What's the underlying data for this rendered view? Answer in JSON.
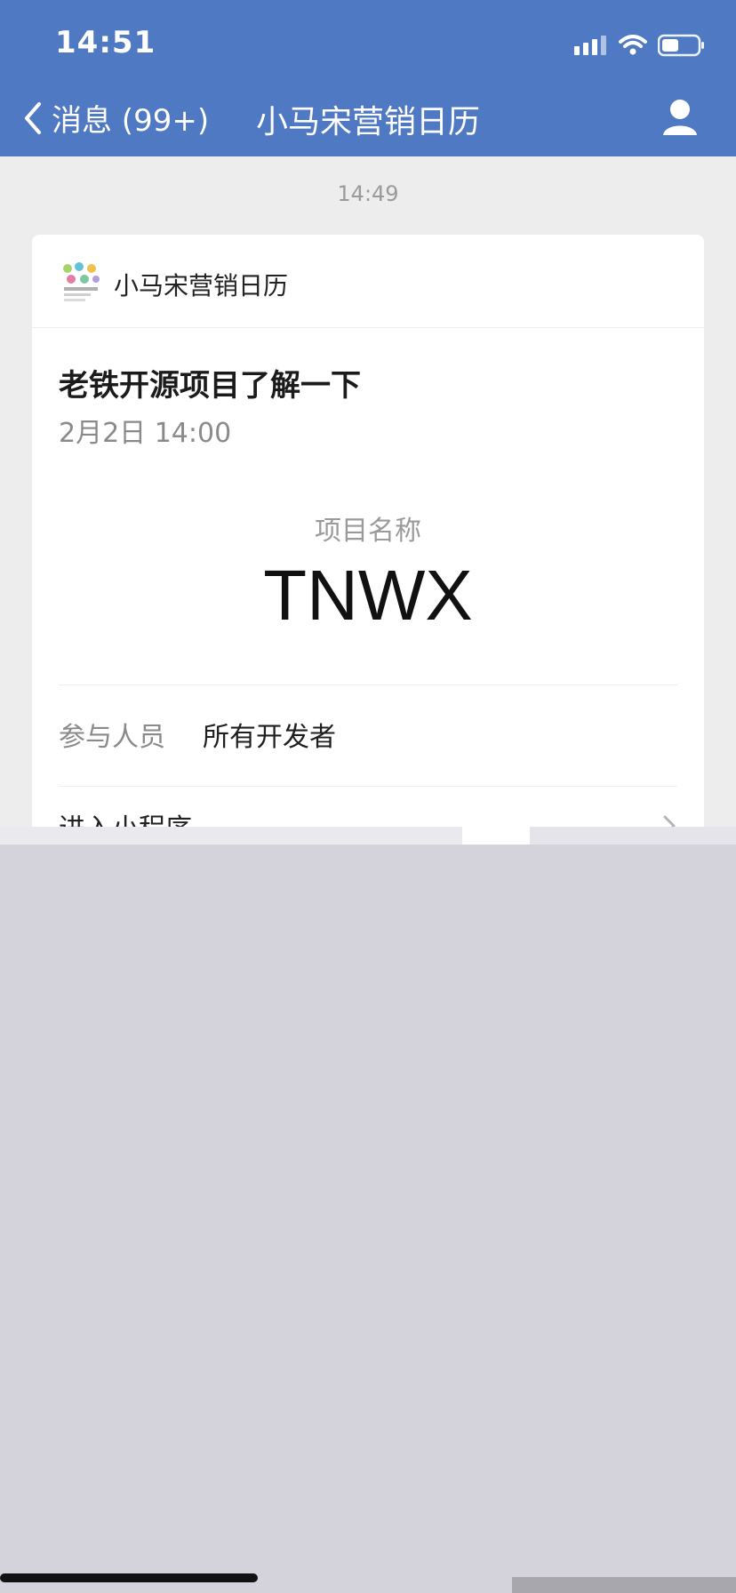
{
  "status_bar": {
    "time": "14:51"
  },
  "nav": {
    "back_label": "消息 (99+)",
    "title": "小马宋营销日历"
  },
  "chat": {
    "timestamp": "14:49"
  },
  "card": {
    "app_name": "小马宋营销日历",
    "title": "老铁开源项目了解一下",
    "datetime": "2月2日 14:00",
    "project_label": "项目名称",
    "project_name": "TNWX",
    "participants_label": "参与人员",
    "participants_value": "所有开发者",
    "enter_label": "进入小程序"
  },
  "icons": {
    "signal": "signal-icon",
    "wifi": "wifi-icon",
    "battery": "battery-icon",
    "back": "chevron-left-icon",
    "profile": "user-icon",
    "chevron": "chevron-right-icon"
  },
  "colors": {
    "nav_bg": "#4f79c2",
    "page_bg": "#ededed",
    "overlay_bg": "#d4d3db"
  }
}
